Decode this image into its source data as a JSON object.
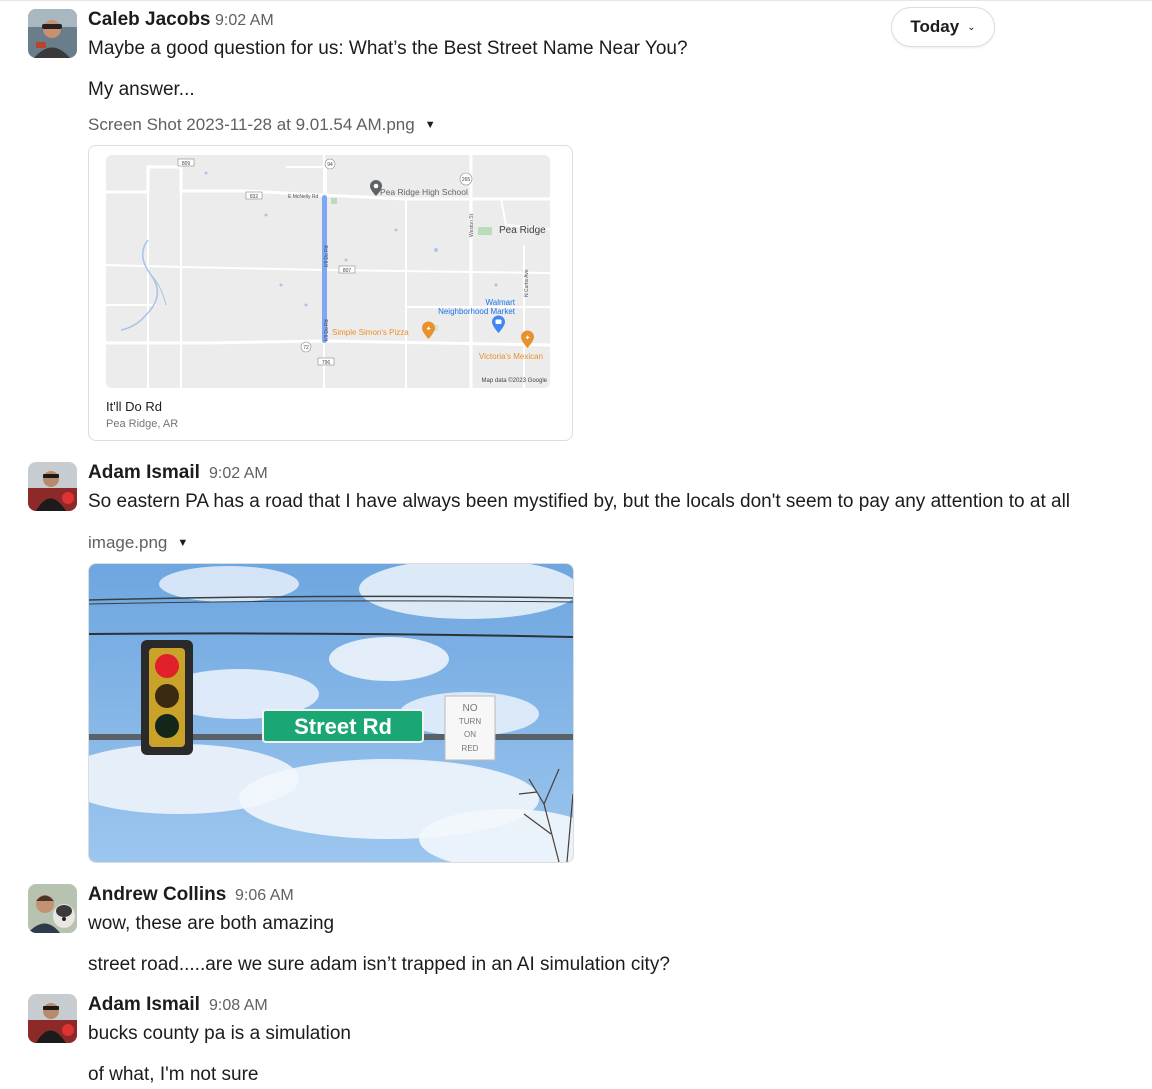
{
  "day_divider": {
    "label": "Today"
  },
  "messages": [
    {
      "author": "Caleb Jacobs",
      "time": "9:02 AM",
      "lines": [
        "Maybe a good question for us: What’s the Best Street Name Near You?",
        "My answer..."
      ],
      "attachment": {
        "filename": "Screen Shot 2023-11-28 at 9.01.54 AM.png",
        "map": {
          "place_title": "It'll Do Rd",
          "place_subtitle": "Pea Ridge, AR",
          "labels": {
            "school": "Pea Ridge High School",
            "town": "Pea Ridge",
            "walmart_1": "Walmart",
            "walmart_2": "Neighborhood Market",
            "pizza": "Simple Simon's Pizza",
            "mexican": "Victoria's Mexican",
            "credit": "Map data ©2023 Google",
            "mcnelly": "E McNelly Rd",
            "weston": "Weston St",
            "curtis": "N Curtis Ave",
            "itlldo": "It'll Do Rd",
            "r809": "809",
            "r832": "832",
            "r94": "94",
            "r265": "265",
            "r807": "807",
            "r72": "72",
            "r796": "796"
          }
        }
      }
    },
    {
      "author": "Adam Ismail",
      "time": "9:02 AM",
      "lines": [
        "So eastern PA has a road that I have always been mystified by, but the locals don't seem to pay any attention to at all"
      ],
      "attachment": {
        "filename": "image.png",
        "photo": {
          "sign_text": "Street Rd",
          "small_sign": [
            "NO",
            "TURN",
            "ON",
            "RED"
          ]
        }
      }
    },
    {
      "author": "Andrew Collins",
      "time": "9:06 AM",
      "lines": [
        "wow, these are both amazing",
        "street road.....are we sure adam isn’t trapped in an AI simulation city?"
      ]
    },
    {
      "author": "Adam Ismail",
      "time": "9:08 AM",
      "lines": [
        "bucks county pa is a simulation",
        "of what, I'm not sure"
      ]
    }
  ],
  "colors": {
    "map_road_highlight": "#7ca8f5",
    "map_marker_blue": "#4285f4",
    "map_marker_orange": "#e8912d",
    "sign_green": "#1aa774",
    "sky_blue": "#7fb4e6"
  }
}
